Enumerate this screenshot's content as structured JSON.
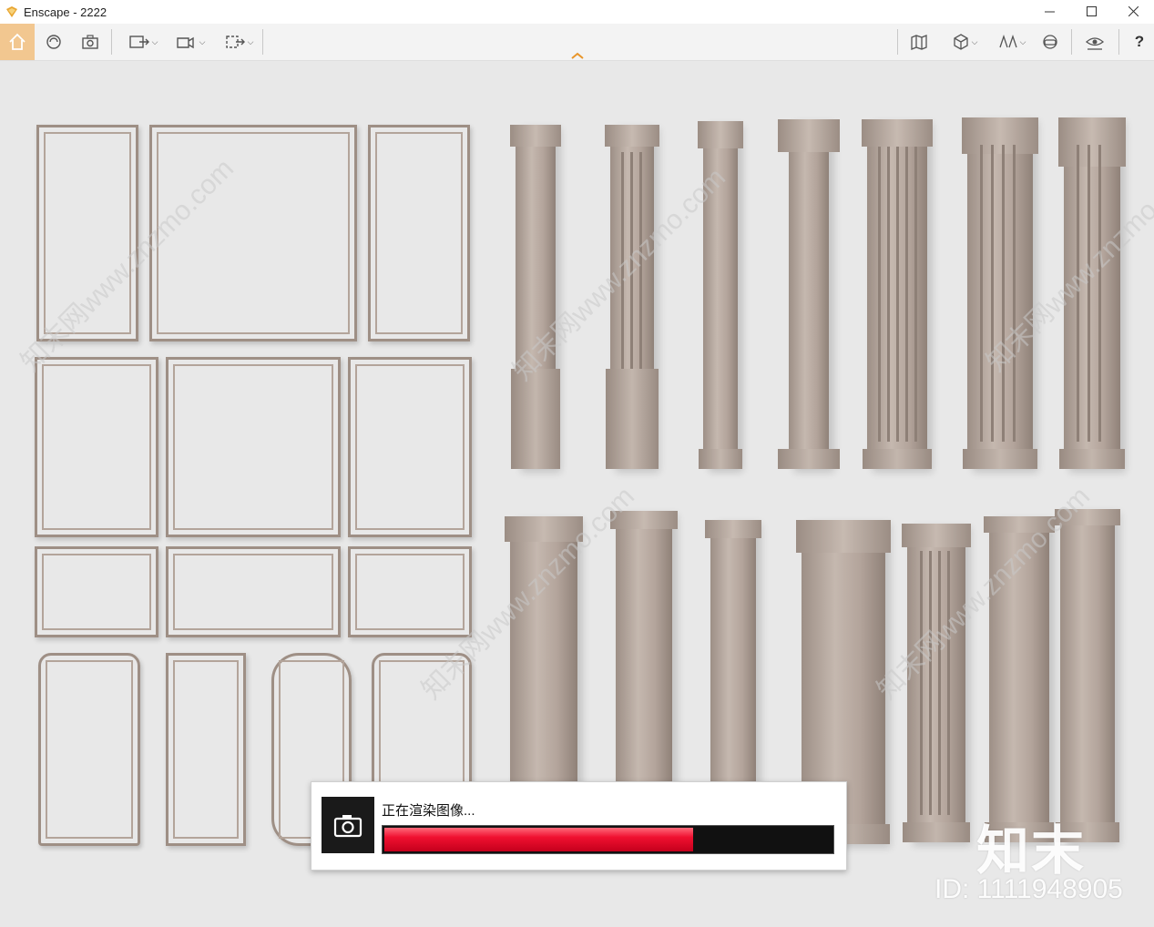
{
  "window": {
    "title": "Enscape - 2222"
  },
  "toolbar": {
    "help_label": "?"
  },
  "render": {
    "status_text": "正在渲染图像...",
    "progress": 0.69
  },
  "watermarks": {
    "brand": "知末",
    "id_label": "ID: 1111948905",
    "repeat_text": "知末网www.znzmo.com"
  }
}
